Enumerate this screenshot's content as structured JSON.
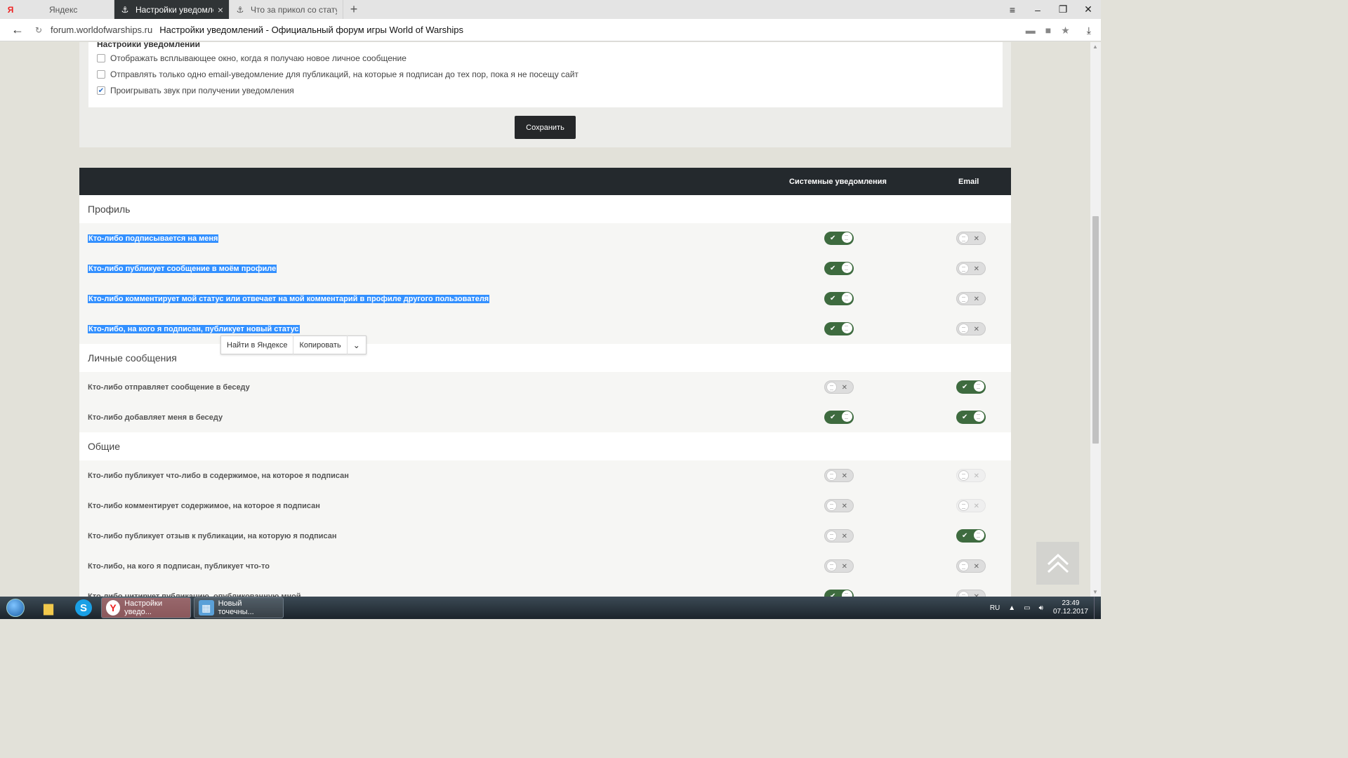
{
  "browser": {
    "tabs": [
      {
        "label": "Яндекс",
        "icon": "yandex-icon"
      },
      {
        "label": "Настройки уведомлений",
        "icon": "wows-icon"
      },
      {
        "label": "Что за прикол со статусом?",
        "icon": "wows-icon"
      }
    ],
    "address": {
      "domain": "forum.worldofwarships.ru",
      "title": "Настройки уведомлений - Официальный форум игры World of Warships"
    }
  },
  "notifications": {
    "title": "Настройки уведомлений",
    "options": [
      {
        "label": "Отображать всплывающее окно, когда я получаю новое личное сообщение",
        "checked": false
      },
      {
        "label": "Отправлять только одно email-уведомление для публикаций, на которые я подписан до тех пор, пока я не посещу сайт",
        "checked": false
      },
      {
        "label": "Проигрывать звук при получении уведомления",
        "checked": true
      }
    ],
    "save_label": "Сохранить"
  },
  "table": {
    "col_system": "Системные уведомления",
    "col_email": "Email",
    "sections": [
      {
        "title": "Профиль",
        "rows": [
          {
            "label": "Кто-либо подписывается на меня",
            "system": "on",
            "email": "off"
          },
          {
            "label": "Кто-либо публикует сообщение в моём профиле",
            "system": "on",
            "email": "off"
          },
          {
            "label": "Кто-либо комментирует мой статус или отвечает на мой комментарий в профиле другого пользователя",
            "system": "on",
            "email": "off"
          },
          {
            "label": "Кто-либо, на кого я подписан, публикует новый статус",
            "system": "on",
            "email": "off"
          }
        ]
      },
      {
        "title": "Личные сообщения",
        "rows": [
          {
            "label": "Кто-либо отправляет сообщение в беседу",
            "system": "off",
            "email": "on"
          },
          {
            "label": "Кто-либо добавляет меня в беседу",
            "system": "on",
            "email": "on"
          }
        ]
      },
      {
        "title": "Общие",
        "rows": [
          {
            "label": "Кто-либо публикует что-либо в содержимое, на которое я подписан",
            "system": "off",
            "email": "disabled"
          },
          {
            "label": "Кто-либо комментирует содержимое, на которое я подписан",
            "system": "off",
            "email": "disabled"
          },
          {
            "label": "Кто-либо публикует отзыв к публикации, на которую я подписан",
            "system": "off",
            "email": "on"
          },
          {
            "label": "Кто-либо, на кого я подписан, публикует что-то",
            "system": "off",
            "email": "off"
          },
          {
            "label": "Кто-либо цитирует публикацию, опубликованную мной",
            "system": "on",
            "email": "off"
          }
        ]
      }
    ]
  },
  "context_menu": {
    "search_label": "Найти в Яндексе",
    "copy_label": "Копировать"
  },
  "taskbar": {
    "apps": [
      {
        "label": "Настройки уведо..."
      },
      {
        "label": "Новый точечны..."
      }
    ],
    "lang": "RU",
    "time": "23:49",
    "date": "07.12.2017"
  }
}
